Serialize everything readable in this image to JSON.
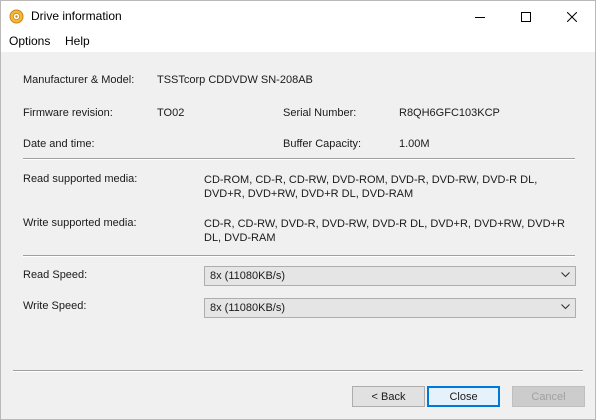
{
  "window": {
    "title": "Drive information",
    "icon": "disc-icon"
  },
  "menu": {
    "items": [
      "Options",
      "Help"
    ]
  },
  "info": {
    "manufacturer_label": "Manufacturer & Model:",
    "manufacturer_value": "TSSTcorp CDDVDW SN-208AB",
    "firmware_label": "Firmware revision:",
    "firmware_value": "TO02",
    "serial_label": "Serial Number:",
    "serial_value": "R8QH6GFC103KCP",
    "datetime_label": "Date and time:",
    "datetime_value": "",
    "buffer_label": "Buffer Capacity:",
    "buffer_value": "1.00M"
  },
  "media": {
    "read_label": "Read supported media:",
    "read_value": "CD-ROM, CD-R, CD-RW, DVD-ROM, DVD-R, DVD-RW, DVD-R DL, DVD+R, DVD+RW, DVD+R DL, DVD-RAM",
    "write_label": "Write supported media:",
    "write_value": "CD-R, CD-RW, DVD-R, DVD-RW, DVD-R DL, DVD+R, DVD+RW, DVD+R DL, DVD-RAM"
  },
  "speed": {
    "read_label": "Read Speed:",
    "read_value": "8x (11080KB/s)",
    "write_label": "Write Speed:",
    "write_value": "8x (11080KB/s)"
  },
  "buttons": {
    "back": "< Back",
    "close": "Close",
    "cancel": "Cancel"
  }
}
